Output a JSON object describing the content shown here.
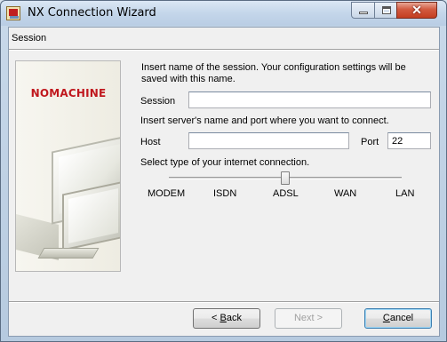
{
  "window": {
    "title": "NX Connection Wizard",
    "controls": {
      "minimize": "minimize",
      "maximize": "maximize",
      "close": "✕"
    }
  },
  "section": {
    "title": "Session"
  },
  "branding": {
    "logo_text": "NOMACHINE",
    "logo_color": "#c0181e"
  },
  "form": {
    "session_intro": "Insert name of the session. Your configuration settings will be saved with this name.",
    "session_label": "Session",
    "session_value": "",
    "server_intro": "Insert server's name and port where you want to connect.",
    "host_label": "Host",
    "host_value": "",
    "port_label": "Port",
    "port_value": "22",
    "connection_intro": "Select type of your internet connection.",
    "connection_options": [
      "MODEM",
      "ISDN",
      "ADSL",
      "WAN",
      "LAN"
    ],
    "connection_selected": "ADSL"
  },
  "buttons": {
    "back": {
      "accel": "B",
      "rest": "ack",
      "prefix": "< "
    },
    "next": {
      "label": "Next >",
      "enabled": false
    },
    "cancel": {
      "accel": "C",
      "rest": "ancel"
    }
  }
}
